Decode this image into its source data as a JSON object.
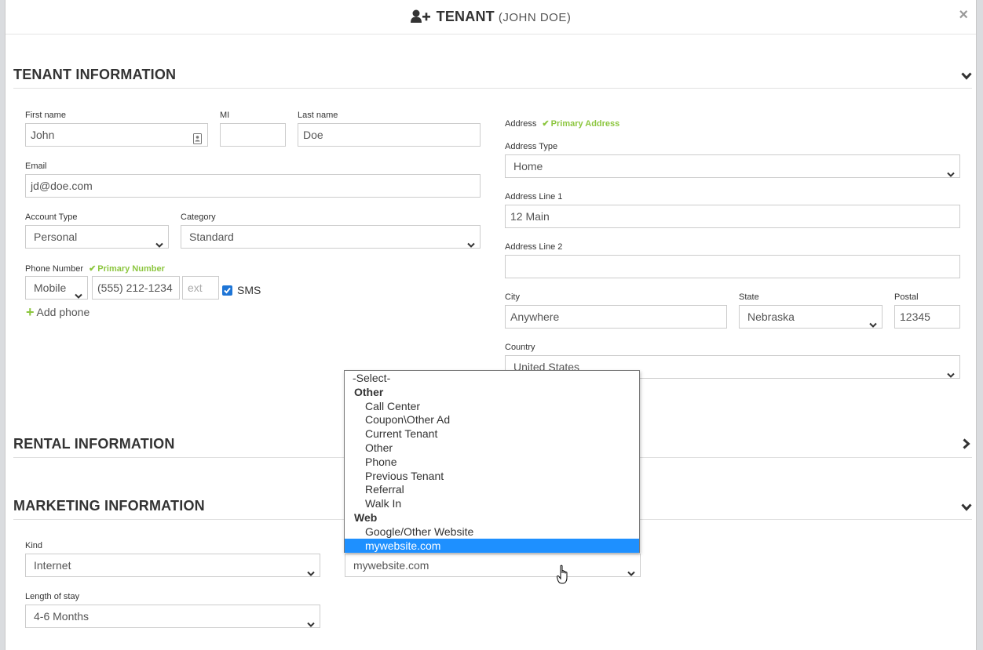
{
  "modal": {
    "title": "TENANT",
    "subtitle": "(JOHN DOE)",
    "close": "×"
  },
  "sections": {
    "tenant": "TENANT INFORMATION",
    "rental": "RENTAL INFORMATION",
    "marketing": "MARKETING INFORMATION"
  },
  "tenant": {
    "first_name_label": "First name",
    "first_name_value": "John",
    "mi_label": "MI",
    "mi_value": "",
    "last_name_label": "Last name",
    "last_name_value": "Doe",
    "email_label": "Email",
    "email_value": "jd@doe.com",
    "account_type_label": "Account Type",
    "account_type_value": "Personal",
    "category_label": "Category",
    "category_value": "Standard",
    "phone_label": "Phone Number",
    "primary_number": "Primary Number",
    "phone_type_value": "Mobile",
    "phone_value": "(555) 212-1234",
    "ext_placeholder": "ext",
    "sms_label": "SMS",
    "sms_checked": true,
    "add_phone": "Add phone"
  },
  "address": {
    "label": "Address",
    "primary_address": "Primary Address",
    "type_label": "Address Type",
    "type_value": "Home",
    "line1_label": "Address Line 1",
    "line1_value": "12 Main",
    "line2_label": "Address Line 2",
    "line2_value": "",
    "city_label": "City",
    "city_value": "Anywhere",
    "state_label": "State",
    "state_value": "Nebraska",
    "postal_label": "Postal",
    "postal_value": "12345",
    "country_label": "Country",
    "country_value": "United States"
  },
  "marketing": {
    "kind_label": "Kind",
    "kind_value": "Internet",
    "source_value": "mywebsite.com",
    "length_label": "Length of stay",
    "length_value": "4-6 Months"
  },
  "source_dropdown": {
    "placeholder": "-Select-",
    "groups": [
      {
        "label": "Other",
        "options": [
          "Call Center",
          "Coupon\\Other Ad",
          "Current Tenant",
          "Other",
          "Phone",
          "Previous Tenant",
          "Referral",
          "Walk In"
        ]
      },
      {
        "label": "Web",
        "options": [
          "Google/Other Website",
          "mywebsite.com"
        ]
      }
    ],
    "highlighted": "mywebsite.com"
  },
  "colors": {
    "accent_green": "#8cc63f",
    "highlight_blue": "#1e90ff",
    "checkbox_blue": "#1e75d6"
  },
  "icons": {
    "title": "add-user-icon",
    "close": "close-icon",
    "contact": "contact-card-icon",
    "check": "check-icon",
    "chevron_down": "chevron-down-icon",
    "chevron_right": "chevron-right-icon",
    "add": "plus-icon",
    "pointer": "hand-pointer-icon"
  }
}
